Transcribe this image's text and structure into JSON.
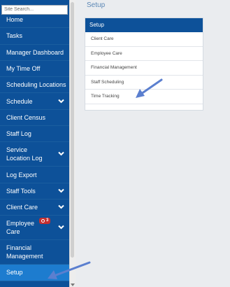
{
  "search": {
    "placeholder": "Site Search..."
  },
  "sidebar": {
    "items": [
      {
        "label": "Home",
        "lines": 1,
        "chevron": false
      },
      {
        "label": "Tasks",
        "lines": 1,
        "chevron": false
      },
      {
        "label": "Manager Dashboard",
        "lines": 1,
        "chevron": false
      },
      {
        "label": "My Time Off",
        "lines": 1,
        "chevron": false
      },
      {
        "label": "Scheduling Locations",
        "lines": 1,
        "chevron": false
      },
      {
        "label": "Schedule",
        "lines": 1,
        "chevron": true
      },
      {
        "label": "Client Census",
        "lines": 1,
        "chevron": false
      },
      {
        "label": "Staff Log",
        "lines": 1,
        "chevron": false
      },
      {
        "label": "Service Location Log",
        "lines": 2,
        "chevron": true
      },
      {
        "label": "Log Export",
        "lines": 1,
        "chevron": false
      },
      {
        "label": "Staff Tools",
        "lines": 1,
        "chevron": true
      },
      {
        "label": "Client Care",
        "lines": 1,
        "chevron": true
      },
      {
        "label": "Employee Care",
        "lines": 2,
        "chevron": true,
        "badge": "3"
      },
      {
        "label": "Financial Management",
        "lines": 2,
        "chevron": false
      },
      {
        "label": "Setup",
        "lines": 1,
        "chevron": false,
        "active": true
      }
    ]
  },
  "main": {
    "title": "Setup",
    "panel": {
      "header": "Setup",
      "links": [
        "Client Care",
        "Employee Care",
        "Financial Management",
        "Staff Scheduling",
        "Time Tracking"
      ]
    }
  },
  "colors": {
    "sidebar_bg": "#0d5199",
    "active_item": "#1d7ccf",
    "badge": "#c52f2f",
    "arrow": "#5b7fcf"
  }
}
